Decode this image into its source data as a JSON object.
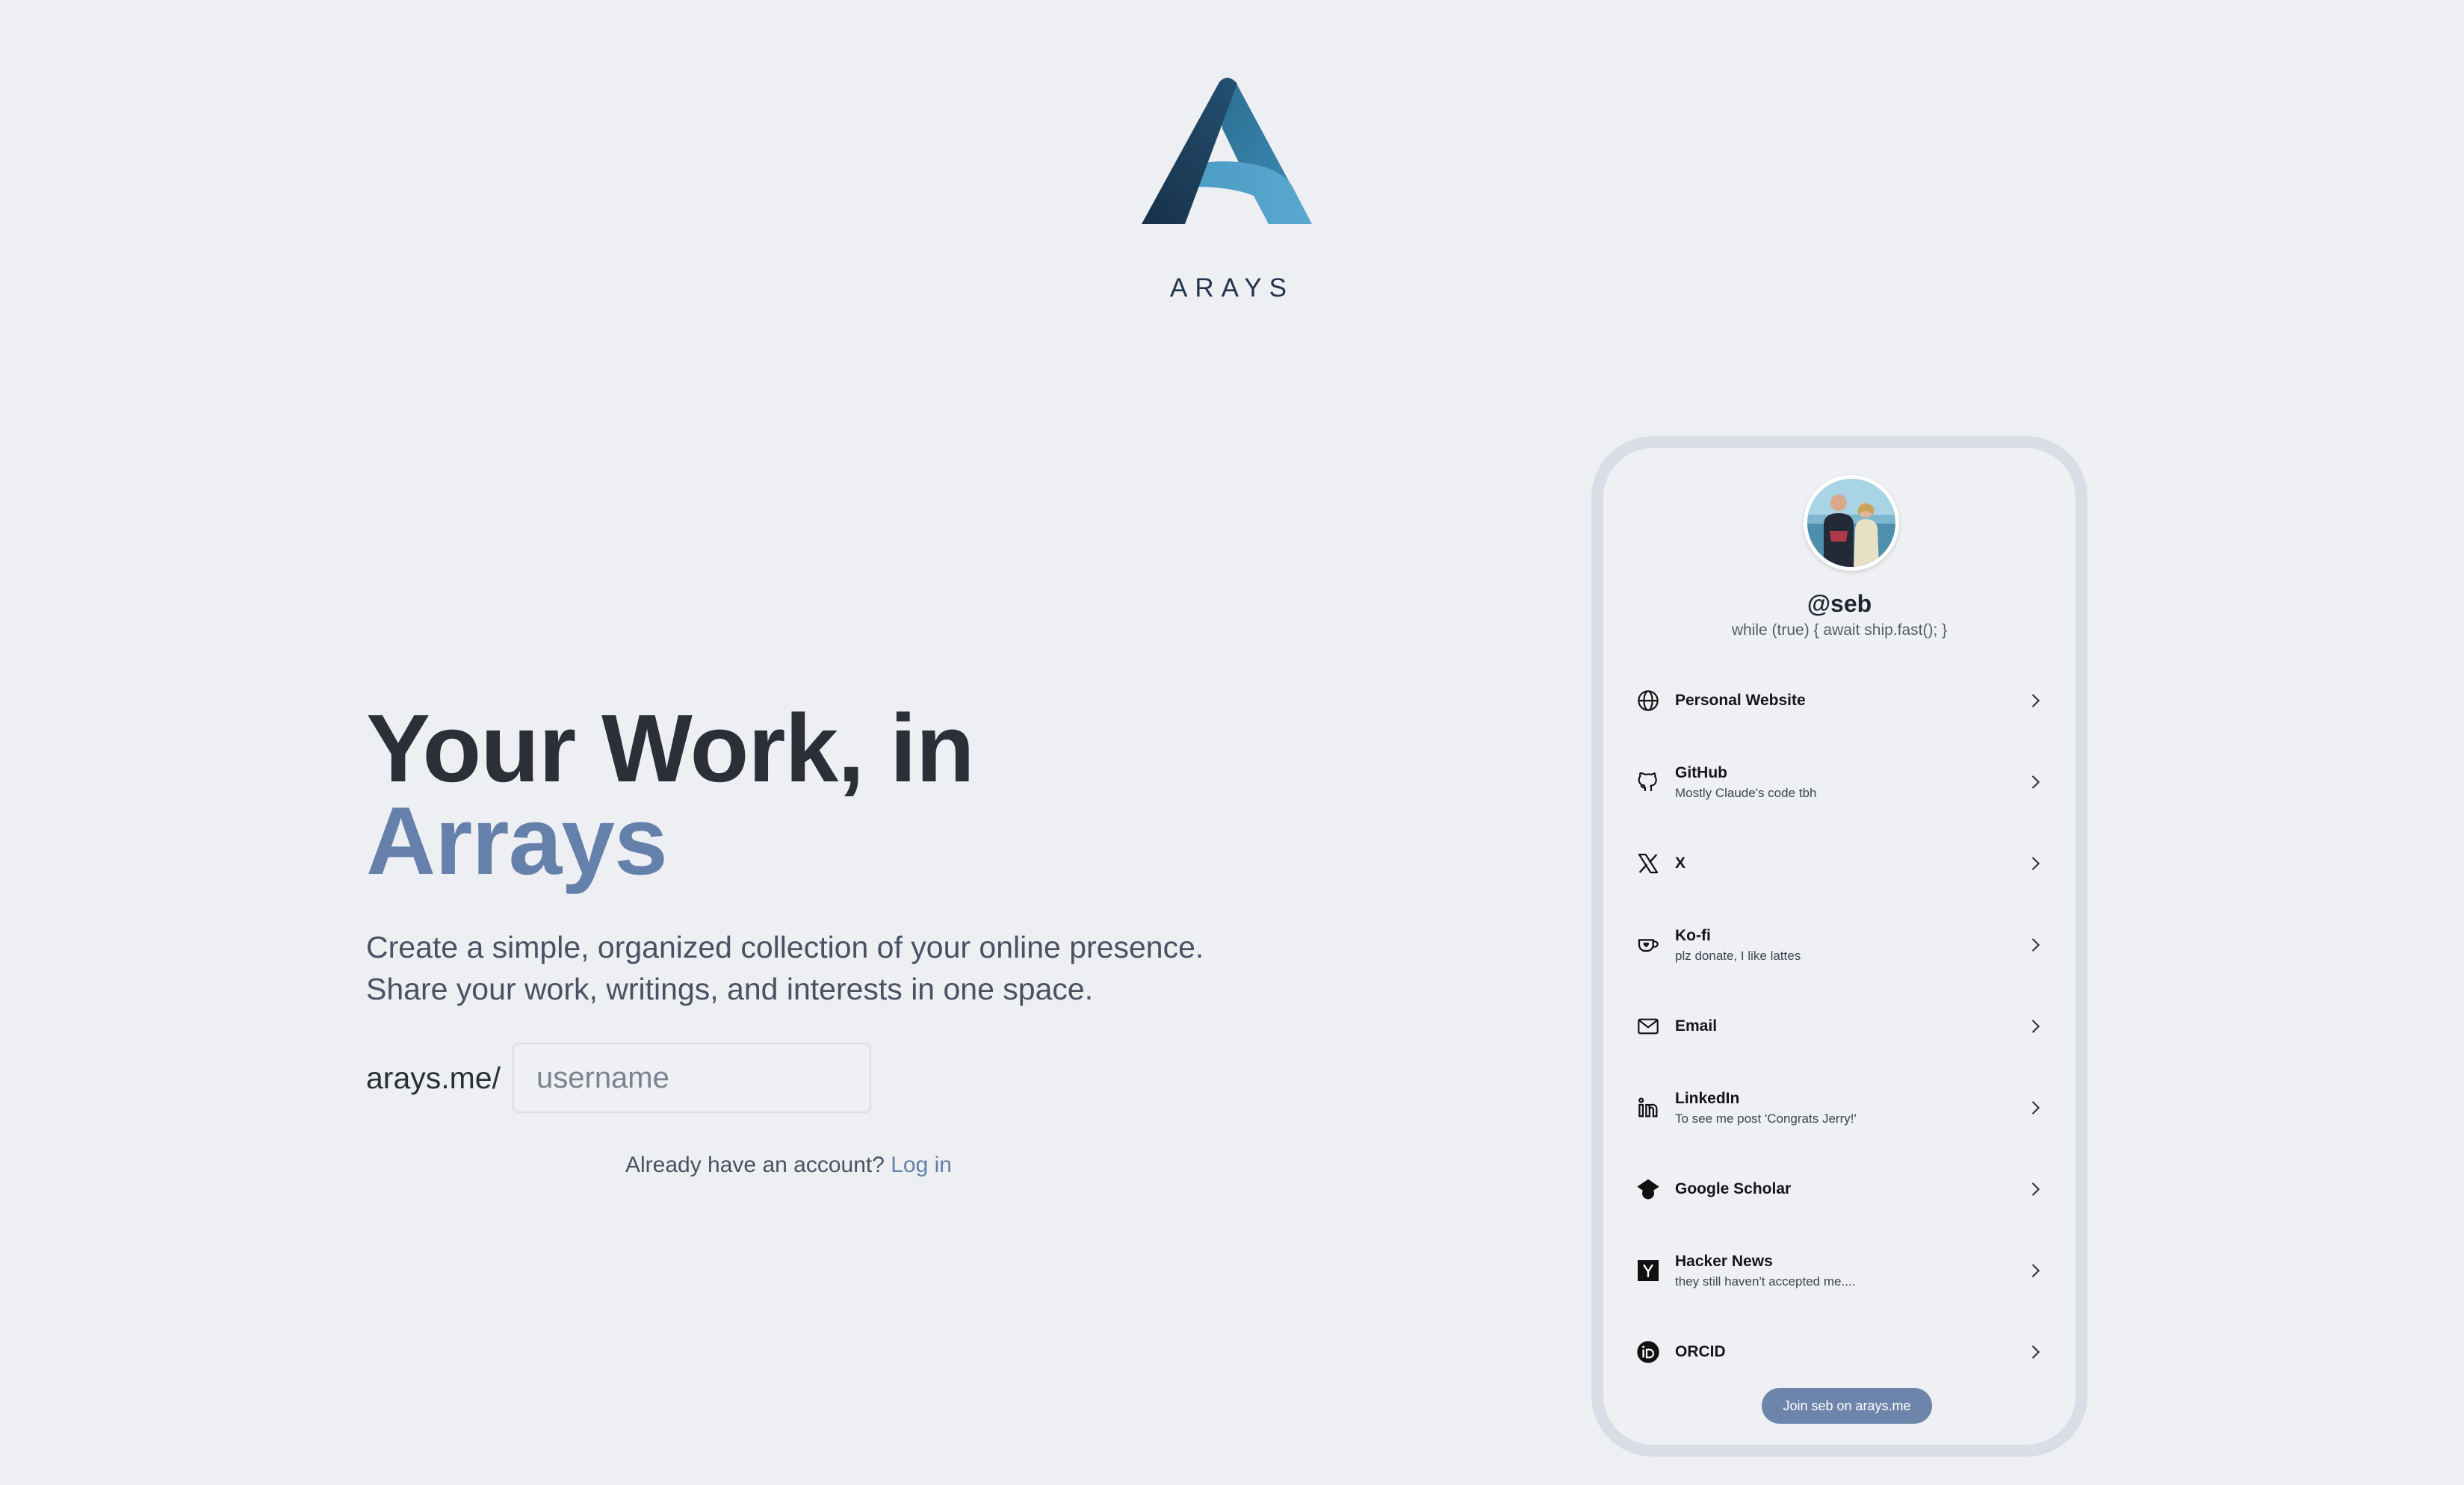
{
  "brand": {
    "name": "ARAYS",
    "colors": {
      "logo_dark": "#1d3a55",
      "logo_mid": "#2f7599",
      "logo_light": "#58a6cc"
    }
  },
  "hero": {
    "title_line1": "Your Work, in",
    "title_line2": "Arrays",
    "description_line1": "Create a simple, organized collection of your online presence.",
    "description_line2": "Share your work, writings, and interests in one space.",
    "url_prefix": "arays.me/",
    "username_placeholder": "username",
    "username_value": "",
    "login_prompt": "Already have an account?",
    "login_link": "Log in",
    "accent_color": "#6580aa"
  },
  "profile": {
    "handle": "@seb",
    "bio": "while (true) { await ship.fast(); }",
    "links": [
      {
        "title": "Personal Website",
        "subtitle": "",
        "icon": "globe-icon"
      },
      {
        "title": "GitHub",
        "subtitle": "Mostly Claude's code tbh",
        "icon": "github-icon"
      },
      {
        "title": "X",
        "subtitle": "",
        "icon": "x-icon"
      },
      {
        "title": "Ko-fi",
        "subtitle": "plz donate, I like lattes",
        "icon": "kofi-icon"
      },
      {
        "title": "Email",
        "subtitle": "",
        "icon": "mail-icon"
      },
      {
        "title": "LinkedIn",
        "subtitle": "To see me post 'Congrats Jerry!'",
        "icon": "linkedin-icon"
      },
      {
        "title": "Google Scholar",
        "subtitle": "",
        "icon": "graduation-cap-icon"
      },
      {
        "title": "Hacker News",
        "subtitle": "they still haven't accepted me....",
        "icon": "hacker-news-icon"
      },
      {
        "title": "ORCID",
        "subtitle": "",
        "icon": "orcid-icon"
      }
    ],
    "join_button": "Join seb on arays.me",
    "join_button_color": "#6d85ab"
  }
}
